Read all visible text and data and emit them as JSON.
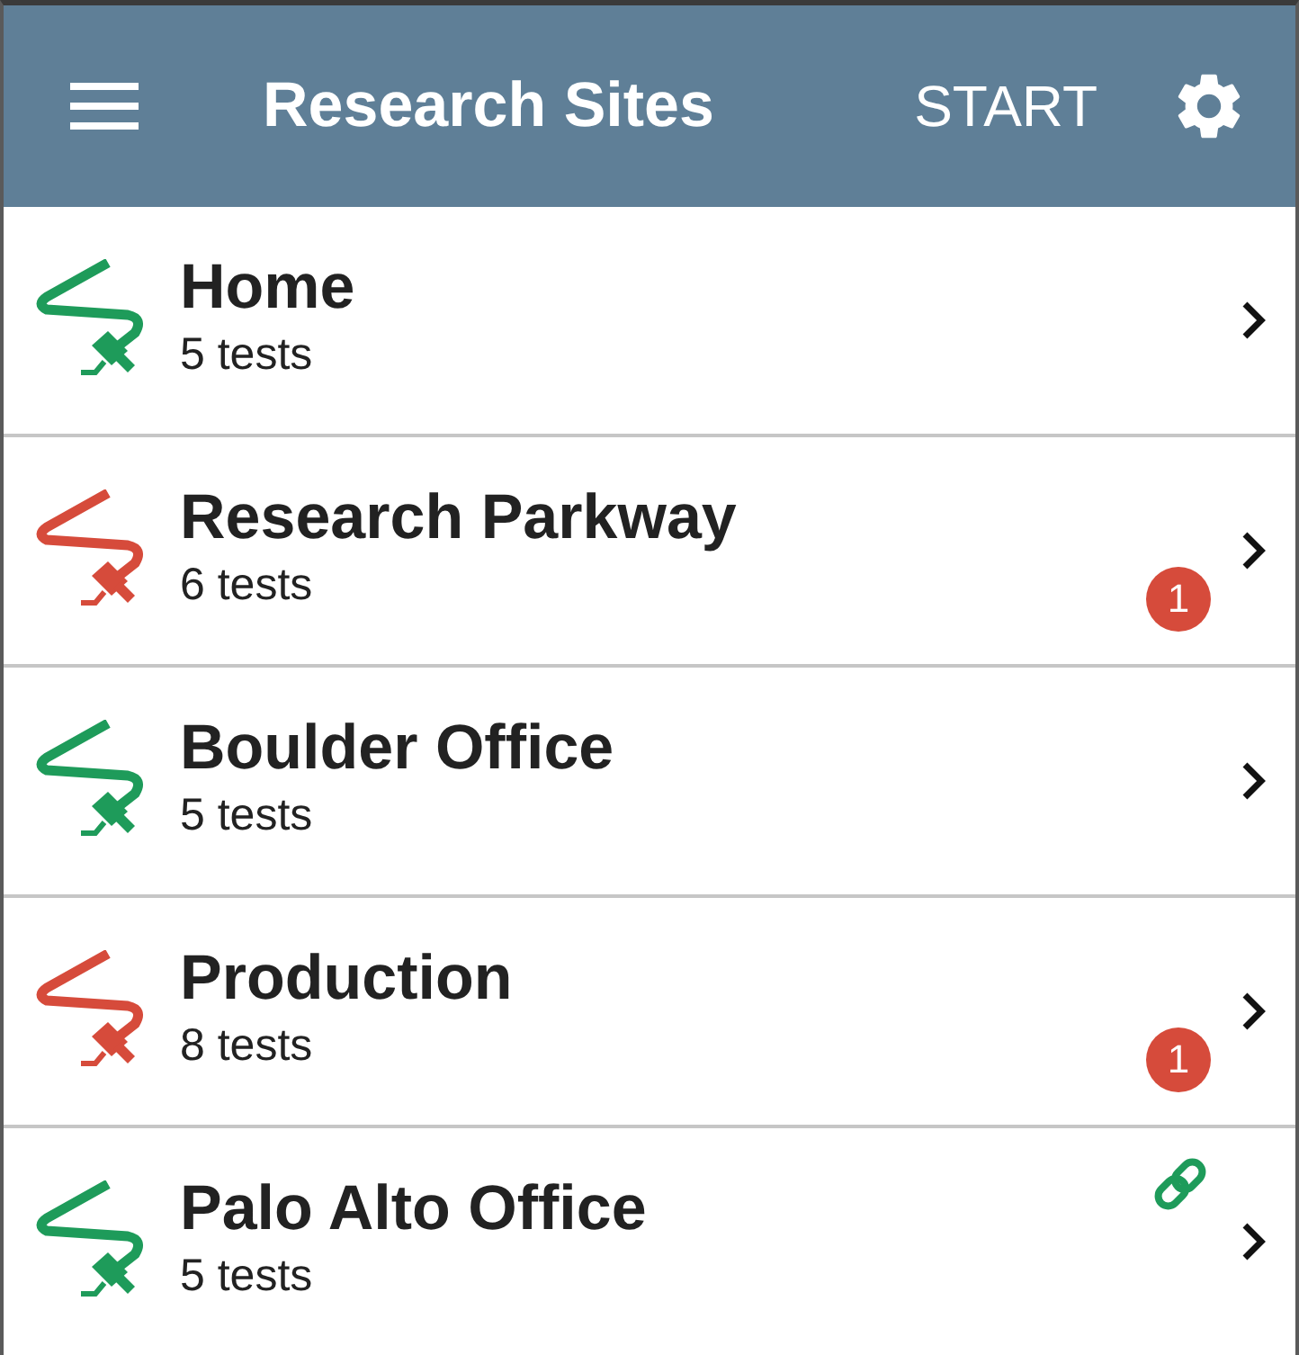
{
  "app_bar": {
    "title": "Research Sites",
    "action": "START"
  },
  "sites": [
    {
      "name": "Home",
      "tests": "5 tests",
      "color": "#1e9b5a",
      "linked": false
    },
    {
      "name": "Research Parkway",
      "tests": "6 tests",
      "color": "#d64b3b",
      "badge": "1",
      "linked": false
    },
    {
      "name": "Boulder Office",
      "tests": "5 tests",
      "color": "#1e9b5a",
      "linked": false
    },
    {
      "name": "Production",
      "tests": "8 tests",
      "color": "#d64b3b",
      "badge": "1",
      "linked": false
    },
    {
      "name": "Palo Alto Office",
      "tests": "5 tests",
      "color": "#1e9b5a",
      "linked": true
    }
  ]
}
